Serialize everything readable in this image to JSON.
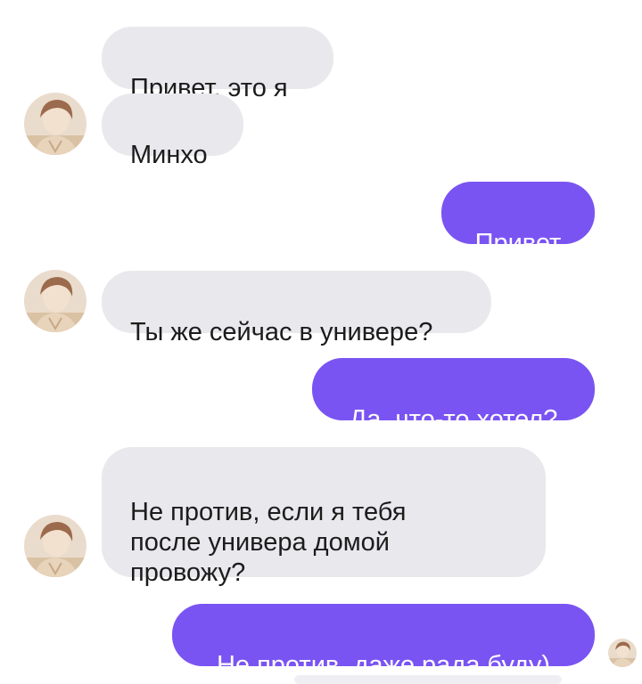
{
  "chat": {
    "colors": {
      "incoming_bubble": "#e9e8ec",
      "outgoing_bubble": "#7a54f2",
      "incoming_text": "#1c1c1c",
      "outgoing_text": "#ffffff"
    },
    "messages": [
      {
        "sender": "contact",
        "text": "Привет, это я"
      },
      {
        "sender": "contact",
        "text": "Минхо"
      },
      {
        "sender": "me",
        "text": "Привет"
      },
      {
        "sender": "contact",
        "text": "Ты же сейчас в универе?"
      },
      {
        "sender": "me",
        "text": "Да, что-то хотел?"
      },
      {
        "sender": "contact",
        "text": "Не против, если я тебя\nпосле универа домой\nпровожу?"
      },
      {
        "sender": "me",
        "text": "Не против, даже рада буду)"
      }
    ],
    "avatar_icon": "contact-photo-avatar",
    "read_receipt_icon": "read-receipt-avatar"
  }
}
